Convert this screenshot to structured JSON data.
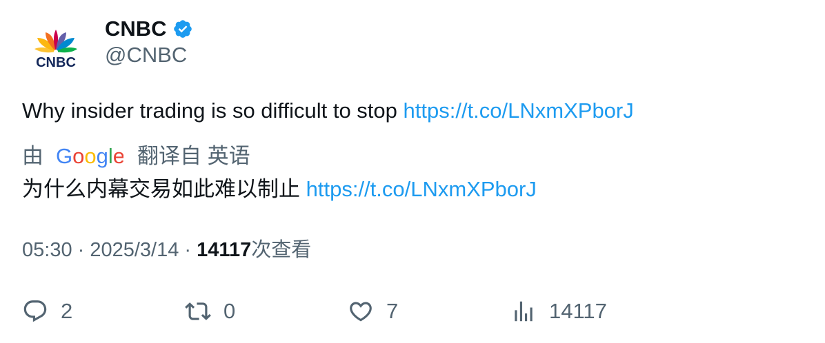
{
  "account": {
    "name": "CNBC",
    "handle": "@CNBC",
    "verified": true,
    "logo_text": "CNBC"
  },
  "tweet": {
    "text": "Why insider trading is so difficult to stop ",
    "link": "https://t.co/LNxmXPborJ"
  },
  "translation": {
    "prefix": "由",
    "provider": "Google",
    "label": "翻译自 英语",
    "text": "为什么内幕交易如此难以制止 ",
    "link": "https://t.co/LNxmXPborJ"
  },
  "meta": {
    "time": "05:30",
    "sep1": " · ",
    "date": "2025/3/14",
    "sep2": " · ",
    "views": "14117",
    "views_label": "次查看"
  },
  "actions": {
    "replies": "2",
    "retweets": "0",
    "likes": "7",
    "views": "14117"
  },
  "colors": {
    "link": "#1d9bf0",
    "secondary_text": "#536471",
    "verified": "#1d9bf0"
  }
}
